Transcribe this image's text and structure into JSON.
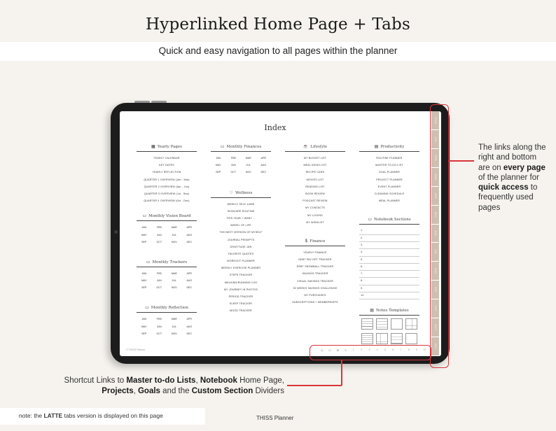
{
  "header": {
    "title": "Hyperlinked Home Page + Tabs",
    "subtitle": "Quick and easy navigation to all pages within the planner"
  },
  "planner": {
    "page_title": "Index",
    "yearly_pages": {
      "title": "Yearly Pages",
      "icon": "calendar-icon",
      "items": [
        "YEARLY CALENDAR",
        "KEY DATES",
        "YEARLY REFLECTION",
        "QUARTER 1 OVERVIEW (Jan - Mar)",
        "QUARTER 2 OVERVIEW (Apr - Jun)",
        "QUARTER 3 OVERVIEW (Jul - Sep)",
        "QUARTER 4 OVERVIEW (Oct - Dec)"
      ]
    },
    "months": [
      "JAN",
      "FEB",
      "MAR",
      "APR",
      "MAY",
      "JUN",
      "JUL",
      "AUG",
      "SEP",
      "OCT",
      "NOV",
      "DEC"
    ],
    "monthly_vision_board": {
      "title": "Monthly Vision Board",
      "icon": "folder-icon"
    },
    "monthly_trackers": {
      "title": "Monthly Trackers",
      "icon": "folder-icon"
    },
    "monthly_reflection": {
      "title": "Monthly Reflection",
      "icon": "folder-icon"
    },
    "monthly_finances": {
      "title": "Monthly Finances",
      "icon": "folder-icon"
    },
    "wellness": {
      "title": "Wellness",
      "icon": "heart-icon",
      "items": [
        "WEEKLY SELF-CARE",
        "SKINCARE ROUTINE",
        "THIS YEAR, I WANT ...",
        "WHEEL OF LIFE",
        "THE BEST VERSION OF MYSELF",
        "JOURNAL PROMPTS",
        "GRATITUDE JAR",
        "FAVORITE QUOTES",
        "WORKOUT PLANNER",
        "WEEKLY EXERCISE PLANNER",
        "STEPS TRACKER",
        "WALKING/RUNNING LOG",
        "MY JOURNEY IN PHOTOS",
        "PERIOD TRACKER",
        "SLEEP TRACKER",
        "MOOD TRACKER"
      ]
    },
    "lifestyle": {
      "title": "Lifestyle",
      "icon": "lifestyle-icon",
      "items": [
        "MY BUCKET LIST",
        "MEAL IDEAS LIST",
        "RECIPE CARD",
        "MOVIES LIST",
        "READING LIST",
        "BOOK REVIEW",
        "PODCAST REVIEW",
        "MY CONTACTS",
        "MY LOGINS",
        "MY WISHLIST"
      ]
    },
    "finance": {
      "title": "Finance",
      "icon": "money-icon",
      "items": [
        "YEARLY FINANCE",
        "DEBT PAY-OFF TRACKER",
        "DEBT SNOWBALL TRACKER",
        "SAVINGS TRACKER",
        "VISUAL SAVINGS TRACKER",
        "52 WEEKS SAVINGS CHALLENGE",
        "MY PURCHASES",
        "SUBSCRIPTIONS + MEMBERSHIPS"
      ]
    },
    "productivity": {
      "title": "Productivity",
      "icon": "productivity-icon",
      "items": [
        "ROUTINE PLANNER",
        "MASTER TO-DO LIST",
        "GOAL PLANNER",
        "PROJECT PLANNER",
        "EVENT PLANNER",
        "CLEANING SCHEDULE",
        "MEAL PLANNER"
      ]
    },
    "notebook_sections": {
      "title": "Notebook Sections",
      "icon": "folder-icon",
      "items": [
        "1.",
        "2.",
        "3.",
        "4.",
        "5.",
        "6.",
        "7.",
        "8.",
        "9.",
        "10."
      ]
    },
    "notes_templates": {
      "title": "Notes Templates",
      "icon": "notes-icon",
      "templates": [
        "lined",
        "grid",
        "blank",
        "cornell",
        "dense-grid",
        "cornell-left",
        "lined-sparse",
        "blank-2"
      ]
    },
    "footer_brand": "© THISS Planner",
    "bottom_links": [
      "◎",
      "☑",
      "⊠",
      "✎",
      "1",
      "2",
      "3",
      "4",
      "5",
      "6",
      "7",
      "8",
      "9",
      "10"
    ],
    "side_tabs": [
      "YEAR",
      "JAN",
      "FEB",
      "MAR",
      "APR",
      "MAY",
      "JUN",
      "JUL",
      "AUG",
      "SEP",
      "OCT",
      "NOV",
      "DEC"
    ]
  },
  "annotations": {
    "right_parts": [
      {
        "text": "The links along the right and bottom are on ",
        "bold": false
      },
      {
        "text": "every page",
        "bold": true
      },
      {
        "text": " of the planner for ",
        "bold": false
      },
      {
        "text": "quick access",
        "bold": true
      },
      {
        "text": " to frequently used pages",
        "bold": false
      }
    ],
    "bottom_parts": [
      {
        "text": "Shortcut Links to ",
        "bold": false
      },
      {
        "text": "Master to-do Lists",
        "bold": true
      },
      {
        "text": ", ",
        "bold": false
      },
      {
        "text": "Notebook",
        "bold": true
      },
      {
        "text": " Home Page, ",
        "bold": false
      },
      {
        "text": "Projects",
        "bold": true
      },
      {
        "text": ", ",
        "bold": false
      },
      {
        "text": "Goals",
        "bold": true
      },
      {
        "text": " and the ",
        "bold": false
      },
      {
        "text": "Custom Section",
        "bold": true
      },
      {
        "text": " Dividers",
        "bold": false
      }
    ],
    "note_parts": [
      {
        "text": "note: the ",
        "bold": false
      },
      {
        "text": "LATTE",
        "bold": true
      },
      {
        "text": " tabs version is displayed on this page",
        "bold": false
      }
    ],
    "brand": "THISS Planner"
  },
  "colors": {
    "accent_red": "#d9343a",
    "tab_latte": "#cdbfb1",
    "background": "#f6f3ee"
  }
}
